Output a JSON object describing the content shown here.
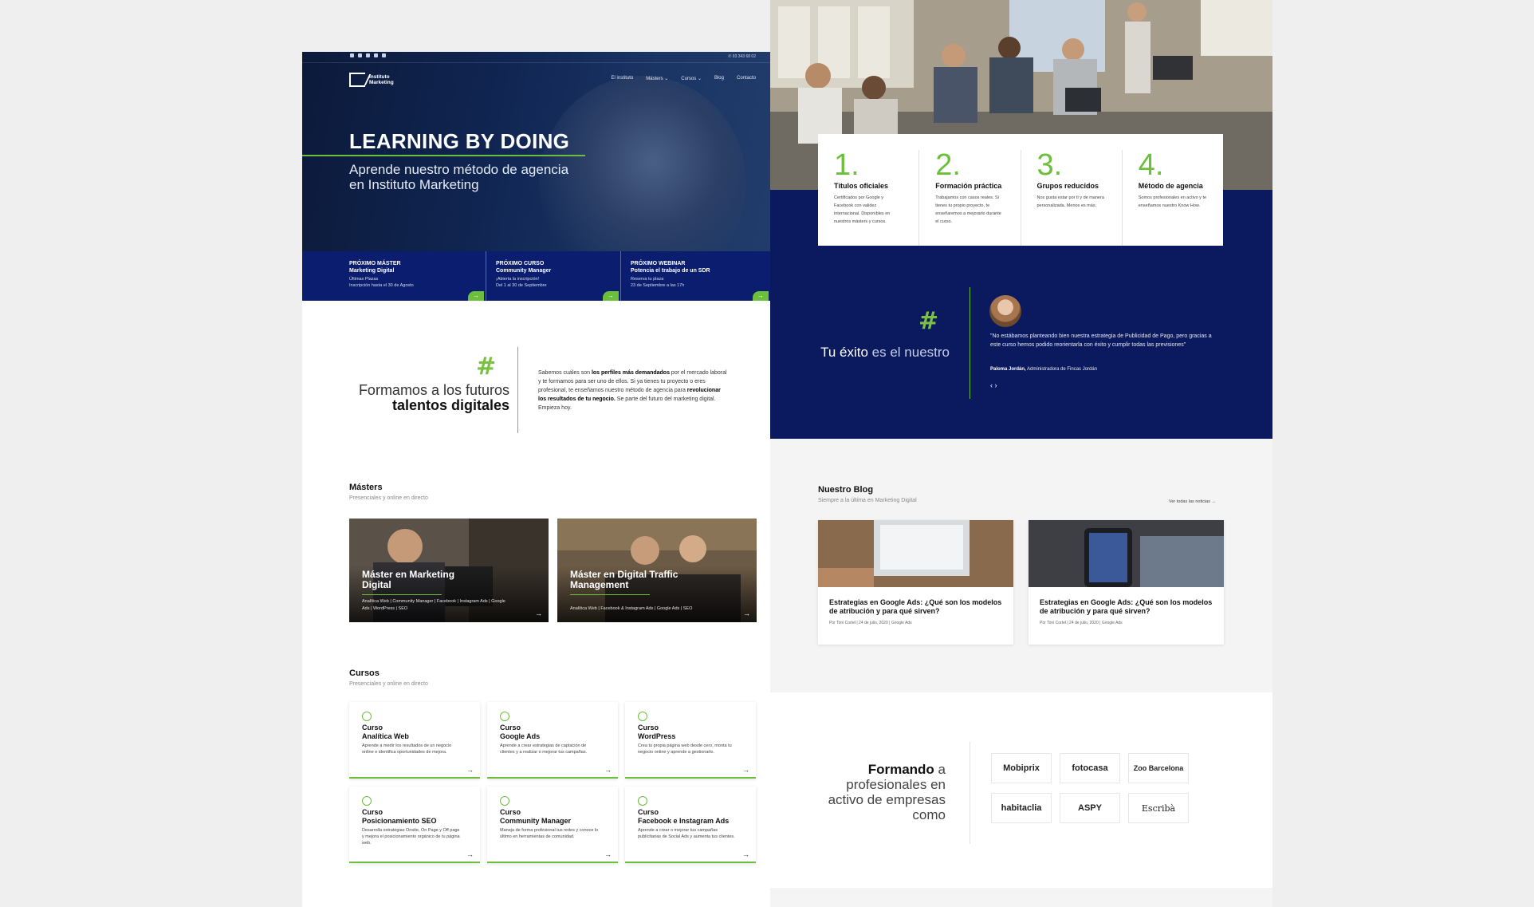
{
  "left_page": {
    "topbar": {
      "phone": "93 343 68 02"
    },
    "logo": {
      "text": "Instituto Marketing"
    },
    "nav": [
      "El instituto",
      "Másters ⌄",
      "Cursos ⌄",
      "Blog",
      "Contacto"
    ],
    "hero": {
      "title": "LEARNING BY DOING",
      "subtitle": "Aprende nuestro método de agencia en Instituto Marketing",
      "boxes": [
        {
          "kicker": "PRÓXIMO MÁSTER",
          "title": "Marketing Digital",
          "line1": "Últimas Plazas",
          "line2": "Inscripción hasta el 30 de Agosto"
        },
        {
          "kicker": "PRÓXIMO CURSO",
          "title": "Community Manager",
          "line1": "¡Abierta la inscripción!",
          "line2": "Del 1 al 30 de Septiembre"
        },
        {
          "kicker": "PRÓXIMO WEBINAR",
          "title": "Potencia el trabajo de un SDR",
          "line1": "Reserva tu plaza",
          "line2": "23 de Septiembre a las 17h"
        }
      ]
    },
    "intro": {
      "title_a": "Formamos a los futuros ",
      "title_b": "talentos digitales",
      "text_1": "Sabemos cuáles son ",
      "text_b1": "los perfiles más demandados",
      "text_2": " por el mercado laboral y te formamos para ser uno de ellos. Si ya tienes tu proyecto o eres profesional, te enseñamos nuestro método de agencia para ",
      "text_b2": "revolucionar los resultados de tu negocio.",
      "text_3": " Se parte del futuro del marketing digital. Empieza hoy."
    },
    "masters": {
      "title": "Másters",
      "subtitle": "Presenciales y online en directo",
      "items": [
        {
          "title": "Máster en Marketing Digital",
          "desc": "Analítica Web | Community Manager | Facebook | Instagram Ads | Google Ads | WordPress | SEO"
        },
        {
          "title": "Máster en Digital Traffic Management",
          "desc": "Analítica Web | Facebook & Instagram Ads | Google Ads | SEO"
        }
      ]
    },
    "cursos": {
      "title": "Cursos",
      "subtitle": "Presenciales y online en directo",
      "items": [
        {
          "kicker": "Curso",
          "title": "Analítica Web",
          "desc": "Aprende a medir los resultados de un negocio online e identifica oportunidades de mejora."
        },
        {
          "kicker": "Curso",
          "title": "Google Ads",
          "desc": "Aprende a crear estrategias de captación de clientes y a realizar o mejorar tus campañas."
        },
        {
          "kicker": "Curso",
          "title": "WordPress",
          "desc": "Crea tu propia página web desde cero, monta tu negocio online y aprende a gestionarlo."
        },
        {
          "kicker": "Curso",
          "title": "Posicionamiento SEO",
          "desc": "Desarrolla estrategias Onsite, On Page y Off page y mejora el posicionamiento orgánico de tu página web."
        },
        {
          "kicker": "Curso",
          "title": "Community Manager",
          "desc": "Maneja de forma profesional tus redes y conoce lo último en herramientas de comunidad."
        },
        {
          "kicker": "Curso",
          "title": "Facebook e Instagram Ads",
          "desc": "Aprende a crear o mejorar tus campañas publicitarias de Social Ads y aumenta tus clientes."
        }
      ]
    }
  },
  "right_page": {
    "steps": [
      {
        "num": "1.",
        "title": "Títulos oficiales",
        "desc": "Certificados por Google y Facebook con validez internacional. Disponibles en nuestros másters y cursos."
      },
      {
        "num": "2.",
        "title": "Formación práctica",
        "desc": "Trabajamos con casos reales. Si tienes tu propio proyecto, te enseñaremos a mejorarlo durante el curso."
      },
      {
        "num": "3.",
        "title": "Grupos reducidos",
        "desc": "Nos gusta estar por ti y de manera personalizada. Menos es más."
      },
      {
        "num": "4.",
        "title": "Método de agencia",
        "desc": "Somos profesionales en activo y te enseñamos nuestro Know How."
      }
    ],
    "testimonial": {
      "title_a": "Tu éxito ",
      "title_b": "es el nuestro",
      "quote": "\"No estábamos planteando bien nuestra estrategia de Publicidad de Pago, pero gracias a este curso hemos podido reorientarla con éxito y cumplir todas las previsiones\"",
      "author_name": "Paloma Jordán,",
      "author_role": " Administradora de Fincas Jordán",
      "arrows": "‹ ›"
    },
    "blog": {
      "title": "Nuestro Blog",
      "subtitle": "Siempre a la última en Marketing Digital",
      "see_all": "Ver todas las noticias →",
      "posts": [
        {
          "title": "Estrategias en Google Ads: ¿Qué son los modelos de atribución y para qué sirven?",
          "meta": "Por Toni Cortel  |  24 de julio, 2020  |  Google Ads"
        },
        {
          "title": "Estrategias en Google Ads: ¿Qué son los modelos de atribución y para qué sirven?",
          "meta": "Por Toni Cortel  |  24 de julio, 2020  |  Google Ads"
        }
      ]
    },
    "clients": {
      "title_a": "Formando ",
      "title_b": "a profesionales en activo de empresas como",
      "logos": [
        "Mobiprix",
        "fotocasa",
        "Zoo Barcelona",
        "habitaclia",
        "ASPY",
        "Escribà"
      ]
    }
  },
  "colors": {
    "accent": "#6cbf3b",
    "navy": "#0b1a5e",
    "hero_dark": "#0c1a3a"
  }
}
